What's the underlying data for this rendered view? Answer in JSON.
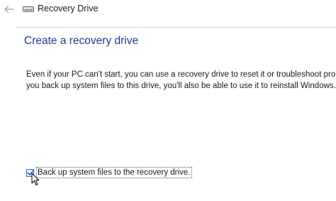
{
  "window": {
    "title": "Recovery Drive",
    "back_icon": "back-arrow-icon",
    "drive_icon": "drive-icon"
  },
  "main": {
    "heading": "Create a recovery drive",
    "paragraph_lines": [
      "Even if your PC can't start, you can use a recovery drive to reset it or troubleshoot probler",
      "you back up system files to this drive, you'll also be able to use it to reinstall Windows."
    ],
    "backup_option": {
      "label": "Back up system files to the recovery drive.",
      "checked": true
    }
  },
  "colors": {
    "heading": "#1f3c88",
    "checkbox_accent": "#2a6fc9"
  }
}
